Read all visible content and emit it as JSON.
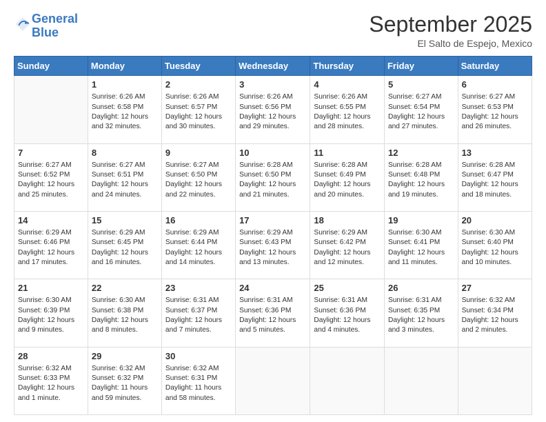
{
  "header": {
    "logo_line1": "General",
    "logo_line2": "Blue",
    "month_title": "September 2025",
    "location": "El Salto de Espejo, Mexico"
  },
  "days_header": [
    "Sunday",
    "Monday",
    "Tuesday",
    "Wednesday",
    "Thursday",
    "Friday",
    "Saturday"
  ],
  "weeks": [
    [
      {
        "day": "",
        "content": ""
      },
      {
        "day": "1",
        "content": "Sunrise: 6:26 AM\nSunset: 6:58 PM\nDaylight: 12 hours and 32 minutes."
      },
      {
        "day": "2",
        "content": "Sunrise: 6:26 AM\nSunset: 6:57 PM\nDaylight: 12 hours and 30 minutes."
      },
      {
        "day": "3",
        "content": "Sunrise: 6:26 AM\nSunset: 6:56 PM\nDaylight: 12 hours and 29 minutes."
      },
      {
        "day": "4",
        "content": "Sunrise: 6:26 AM\nSunset: 6:55 PM\nDaylight: 12 hours and 28 minutes."
      },
      {
        "day": "5",
        "content": "Sunrise: 6:27 AM\nSunset: 6:54 PM\nDaylight: 12 hours and 27 minutes."
      },
      {
        "day": "6",
        "content": "Sunrise: 6:27 AM\nSunset: 6:53 PM\nDaylight: 12 hours and 26 minutes."
      }
    ],
    [
      {
        "day": "7",
        "content": "Sunrise: 6:27 AM\nSunset: 6:52 PM\nDaylight: 12 hours and 25 minutes."
      },
      {
        "day": "8",
        "content": "Sunrise: 6:27 AM\nSunset: 6:51 PM\nDaylight: 12 hours and 24 minutes."
      },
      {
        "day": "9",
        "content": "Sunrise: 6:27 AM\nSunset: 6:50 PM\nDaylight: 12 hours and 22 minutes."
      },
      {
        "day": "10",
        "content": "Sunrise: 6:28 AM\nSunset: 6:50 PM\nDaylight: 12 hours and 21 minutes."
      },
      {
        "day": "11",
        "content": "Sunrise: 6:28 AM\nSunset: 6:49 PM\nDaylight: 12 hours and 20 minutes."
      },
      {
        "day": "12",
        "content": "Sunrise: 6:28 AM\nSunset: 6:48 PM\nDaylight: 12 hours and 19 minutes."
      },
      {
        "day": "13",
        "content": "Sunrise: 6:28 AM\nSunset: 6:47 PM\nDaylight: 12 hours and 18 minutes."
      }
    ],
    [
      {
        "day": "14",
        "content": "Sunrise: 6:29 AM\nSunset: 6:46 PM\nDaylight: 12 hours and 17 minutes."
      },
      {
        "day": "15",
        "content": "Sunrise: 6:29 AM\nSunset: 6:45 PM\nDaylight: 12 hours and 16 minutes."
      },
      {
        "day": "16",
        "content": "Sunrise: 6:29 AM\nSunset: 6:44 PM\nDaylight: 12 hours and 14 minutes."
      },
      {
        "day": "17",
        "content": "Sunrise: 6:29 AM\nSunset: 6:43 PM\nDaylight: 12 hours and 13 minutes."
      },
      {
        "day": "18",
        "content": "Sunrise: 6:29 AM\nSunset: 6:42 PM\nDaylight: 12 hours and 12 minutes."
      },
      {
        "day": "19",
        "content": "Sunrise: 6:30 AM\nSunset: 6:41 PM\nDaylight: 12 hours and 11 minutes."
      },
      {
        "day": "20",
        "content": "Sunrise: 6:30 AM\nSunset: 6:40 PM\nDaylight: 12 hours and 10 minutes."
      }
    ],
    [
      {
        "day": "21",
        "content": "Sunrise: 6:30 AM\nSunset: 6:39 PM\nDaylight: 12 hours and 9 minutes."
      },
      {
        "day": "22",
        "content": "Sunrise: 6:30 AM\nSunset: 6:38 PM\nDaylight: 12 hours and 8 minutes."
      },
      {
        "day": "23",
        "content": "Sunrise: 6:31 AM\nSunset: 6:37 PM\nDaylight: 12 hours and 7 minutes."
      },
      {
        "day": "24",
        "content": "Sunrise: 6:31 AM\nSunset: 6:36 PM\nDaylight: 12 hours and 5 minutes."
      },
      {
        "day": "25",
        "content": "Sunrise: 6:31 AM\nSunset: 6:36 PM\nDaylight: 12 hours and 4 minutes."
      },
      {
        "day": "26",
        "content": "Sunrise: 6:31 AM\nSunset: 6:35 PM\nDaylight: 12 hours and 3 minutes."
      },
      {
        "day": "27",
        "content": "Sunrise: 6:32 AM\nSunset: 6:34 PM\nDaylight: 12 hours and 2 minutes."
      }
    ],
    [
      {
        "day": "28",
        "content": "Sunrise: 6:32 AM\nSunset: 6:33 PM\nDaylight: 12 hours and 1 minute."
      },
      {
        "day": "29",
        "content": "Sunrise: 6:32 AM\nSunset: 6:32 PM\nDaylight: 11 hours and 59 minutes."
      },
      {
        "day": "30",
        "content": "Sunrise: 6:32 AM\nSunset: 6:31 PM\nDaylight: 11 hours and 58 minutes."
      },
      {
        "day": "",
        "content": ""
      },
      {
        "day": "",
        "content": ""
      },
      {
        "day": "",
        "content": ""
      },
      {
        "day": "",
        "content": ""
      }
    ]
  ]
}
